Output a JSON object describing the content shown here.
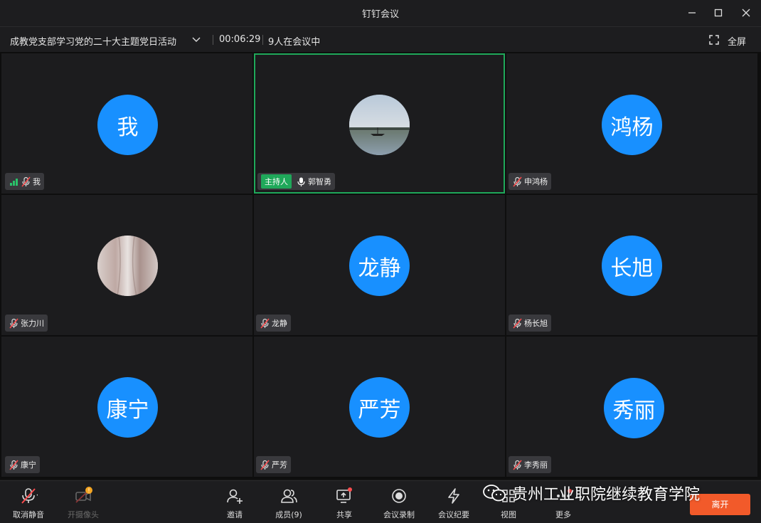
{
  "window": {
    "title": "钉钉会议"
  },
  "meeting": {
    "title": "成教党支部学习党的二十大主题党日活动",
    "timer": "00:06:29",
    "participant_count": "9人在会议中",
    "fullscreen_label": "全屏"
  },
  "participants": [
    {
      "avatar_text": "我",
      "name": "我",
      "muted": true,
      "signal": true
    },
    {
      "avatar_text": "",
      "name": "郭智勇",
      "host_label": "主持人",
      "muted": false,
      "photo": "lake",
      "active": true
    },
    {
      "avatar_text": "鸿杨",
      "name": "申鸿杨",
      "muted": true
    },
    {
      "avatar_text": "",
      "name": "张力川",
      "muted": true,
      "photo": "marble"
    },
    {
      "avatar_text": "龙静",
      "name": "龙静",
      "muted": true
    },
    {
      "avatar_text": "长旭",
      "name": "杨长旭",
      "muted": true
    },
    {
      "avatar_text": "康宁",
      "name": "康宁",
      "muted": true
    },
    {
      "avatar_text": "严芳",
      "name": "严芳",
      "muted": true
    },
    {
      "avatar_text": "秀丽",
      "name": "李秀丽",
      "muted": true
    }
  ],
  "toolbar": {
    "unmute": "取消静音",
    "camera": "开摄像头",
    "invite": "邀请",
    "members": "成员(9)",
    "share": "共享",
    "record": "会议录制",
    "minutes": "会议纪要",
    "view": "视图",
    "more": "更多",
    "leave": "离开"
  },
  "watermark": "贵州工业职院继续教育学院",
  "colors": {
    "accent": "#1890ff",
    "host_green": "#1fa85a",
    "leave": "#f25a2a",
    "notice": "#f5a623"
  }
}
